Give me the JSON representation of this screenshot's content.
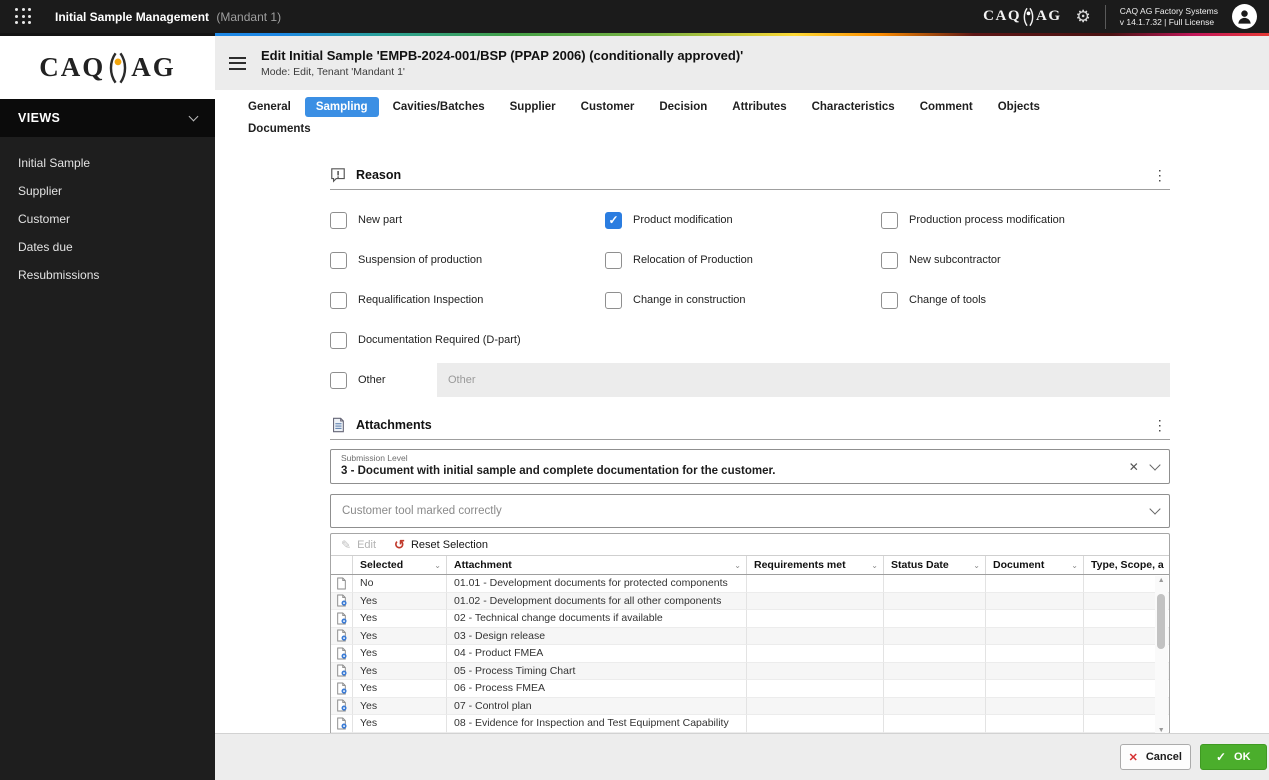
{
  "topbar": {
    "app_title": "Initial Sample Management",
    "tenant": "(Mandant 1)",
    "logo_left": "CAQ",
    "logo_right": "AG",
    "brand_line1": "CAQ AG Factory Systems",
    "brand_line2": "v 14.1.7.32  |  Full License"
  },
  "sidebar": {
    "section_title": "VIEWS",
    "items": [
      {
        "label": "Initial Sample"
      },
      {
        "label": "Supplier"
      },
      {
        "label": "Customer"
      },
      {
        "label": "Dates due"
      },
      {
        "label": "Resubmissions"
      }
    ]
  },
  "header": {
    "title": "Edit Initial Sample 'EMPB-2024-001/BSP (PPAP 2006) (conditionally approved)'",
    "subtitle": "Mode: Edit, Tenant 'Mandant 1'"
  },
  "tabs": {
    "items": [
      {
        "label": "General",
        "active": false
      },
      {
        "label": "Sampling",
        "active": true
      },
      {
        "label": "Cavities/Batches",
        "active": false
      },
      {
        "label": "Supplier",
        "active": false
      },
      {
        "label": "Customer",
        "active": false
      },
      {
        "label": "Decision",
        "active": false
      },
      {
        "label": "Attributes",
        "active": false
      },
      {
        "label": "Characteristics",
        "active": false
      },
      {
        "label": "Comment",
        "active": false
      },
      {
        "label": "Objects",
        "active": false
      },
      {
        "label": "Documents",
        "active": false
      }
    ]
  },
  "reason": {
    "title": "Reason",
    "checkboxes": [
      {
        "label": "New part",
        "checked": false
      },
      {
        "label": "Product modification",
        "checked": true
      },
      {
        "label": "Production process modification",
        "checked": false
      },
      {
        "label": "Suspension of production",
        "checked": false
      },
      {
        "label": "Relocation of Production",
        "checked": false
      },
      {
        "label": "New subcontractor",
        "checked": false
      },
      {
        "label": "Requalification Inspection",
        "checked": false
      },
      {
        "label": "Change in construction",
        "checked": false
      },
      {
        "label": "Change of tools",
        "checked": false
      },
      {
        "label": "Documentation Required (D-part)",
        "checked": false
      },
      {
        "label": "Other",
        "checked": false
      }
    ],
    "other_placeholder": "Other"
  },
  "attachments": {
    "title": "Attachments",
    "submission_level": {
      "label": "Submission Level",
      "value": "3 - Document with initial sample and complete documentation for the customer."
    },
    "tool_dropdown": {
      "placeholder": "Customer tool marked correctly"
    },
    "toolbar": {
      "edit_label": "Edit",
      "reset_label": "Reset Selection"
    },
    "table": {
      "columns": {
        "selected": "Selected",
        "attachment": "Attachment",
        "requirements": "Requirements met",
        "status_date": "Status Date",
        "document": "Document",
        "type_scope": "Type, Scope, a"
      },
      "rows": [
        {
          "selected": "No",
          "attachment": "01.01 - Development documents for protected components",
          "requirements": "",
          "status_date": "",
          "document": "",
          "type_scope": "",
          "has_doc": false
        },
        {
          "selected": "Yes",
          "attachment": "01.02 - Development documents for all other components",
          "requirements": "",
          "status_date": "",
          "document": "",
          "type_scope": "",
          "has_doc": true
        },
        {
          "selected": "Yes",
          "attachment": "02 - Technical change documents if available",
          "requirements": "",
          "status_date": "",
          "document": "",
          "type_scope": "",
          "has_doc": true
        },
        {
          "selected": "Yes",
          "attachment": "03 - Design release",
          "requirements": "",
          "status_date": "",
          "document": "",
          "type_scope": "",
          "has_doc": true
        },
        {
          "selected": "Yes",
          "attachment": "04 - Product FMEA",
          "requirements": "",
          "status_date": "",
          "document": "",
          "type_scope": "",
          "has_doc": true
        },
        {
          "selected": "Yes",
          "attachment": "05 - Process Timing Chart",
          "requirements": "",
          "status_date": "",
          "document": "",
          "type_scope": "",
          "has_doc": true
        },
        {
          "selected": "Yes",
          "attachment": "06 - Process FMEA",
          "requirements": "",
          "status_date": "",
          "document": "",
          "type_scope": "",
          "has_doc": true
        },
        {
          "selected": "Yes",
          "attachment": "07 - Control plan",
          "requirements": "",
          "status_date": "",
          "document": "",
          "type_scope": "",
          "has_doc": true
        },
        {
          "selected": "Yes",
          "attachment": "08 - Evidence for Inspection and Test Equipment Capability",
          "requirements": "",
          "status_date": "",
          "document": "",
          "type_scope": "",
          "has_doc": true
        },
        {
          "selected": "",
          "attachment": "",
          "requirements": "",
          "status_date": "",
          "document": "",
          "type_scope": "",
          "has_doc": true
        }
      ]
    }
  },
  "footer": {
    "cancel_label": "Cancel",
    "ok_label": "OK"
  },
  "icons": {
    "gear": "⚙",
    "kebab": "⋮",
    "clear_x": "✕",
    "pencil": "✎",
    "undo": "↺",
    "cancel_x": "✕",
    "ok_check": "✓",
    "header_chevron": "⌄",
    "arrow_up": "▲",
    "arrow_down": "▼",
    "arrow_left": "◄",
    "arrow_right": "►"
  },
  "colors": {
    "accent_blue": "#3b8fe4",
    "checkbox_blue": "#2b7de0",
    "ok_green": "#4bae2c",
    "cancel_red": "#d63031"
  }
}
